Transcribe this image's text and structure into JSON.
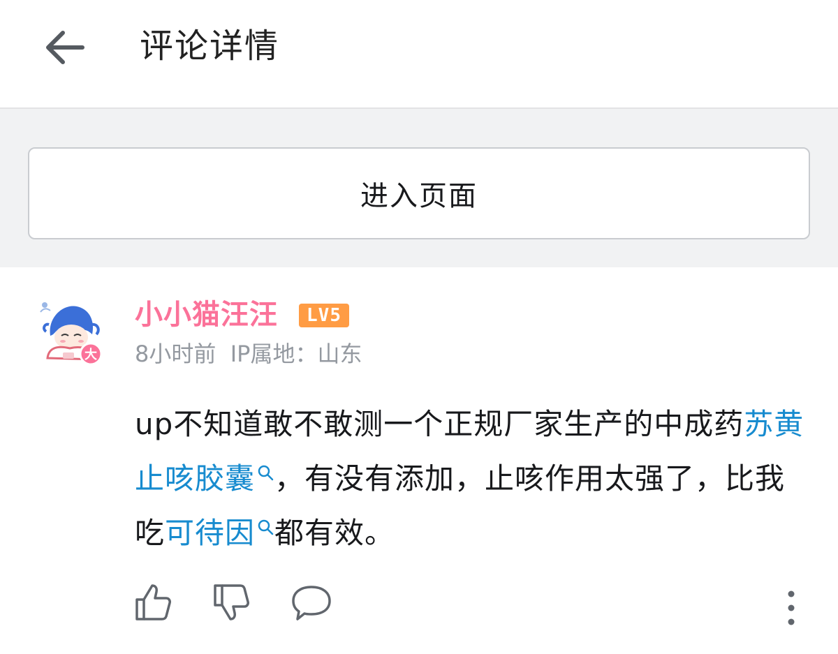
{
  "header": {
    "back_icon": "arrow-left-icon",
    "title": "评论详情"
  },
  "banner": {
    "enter_button_label": "进入页面"
  },
  "comment": {
    "username": "小小猫汪汪",
    "level_badge": "LV5",
    "avatar_badge": "大",
    "time": "8小时前",
    "ip_location": "IP属地：山东",
    "content_parts": {
      "p1": "up不知道敢不敢测一个正规厂家生产的中成药",
      "link1": "苏黄止咳胶囊",
      "p2": "，有没有添加，止咳作用太强了，比我吃",
      "link2": "可待因",
      "p3": "都有效。"
    },
    "actions": {
      "like_icon": "thumbs-up-icon",
      "dislike_icon": "thumbs-down-icon",
      "reply_icon": "chat-bubble-icon",
      "more_icon": "more-vertical-icon"
    }
  },
  "colors": {
    "username": "#fb7299",
    "link": "#178bcf",
    "level_badge": "#ff9c44",
    "meta_text": "#9499a0",
    "band_bg": "#f1f2f3"
  }
}
